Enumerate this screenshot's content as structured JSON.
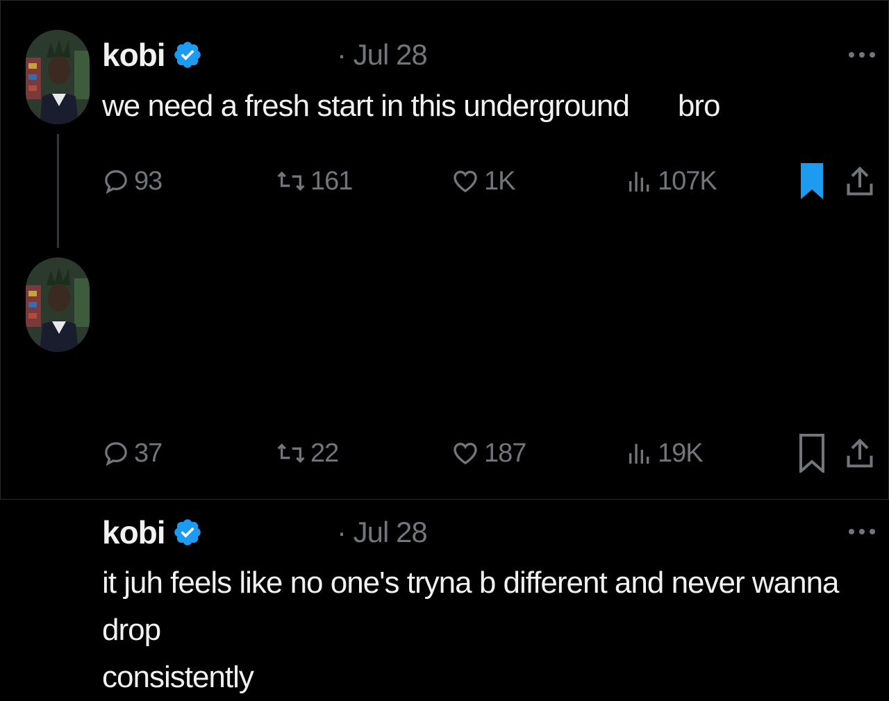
{
  "tweets": [
    {
      "author": "kobi",
      "date": "· Jul 28",
      "text_part1": "we need a fresh start in this underground",
      "text_part2": "bro",
      "replies": "93",
      "reposts": "161",
      "likes": "1K",
      "views": "107K",
      "bookmarked": true
    },
    {
      "author": "kobi",
      "date": "· Jul 28",
      "text_line1": "it juh feels like no one's tryna b different and never wanna drop",
      "text_line2": "consistently",
      "replies": "37",
      "reposts": "22",
      "likes": "187",
      "views": "19K",
      "bookmarked": false
    }
  ],
  "colors": {
    "background": "#000000",
    "text": "#f1f1f1",
    "muted": "#71767b",
    "verified": "#1d9bf0",
    "bookmark_active": "#1d9bf0"
  },
  "icons": [
    "verified-badge-icon",
    "more-icon",
    "reply-icon",
    "retweet-icon",
    "like-icon",
    "views-icon",
    "bookmark-icon",
    "share-icon"
  ]
}
